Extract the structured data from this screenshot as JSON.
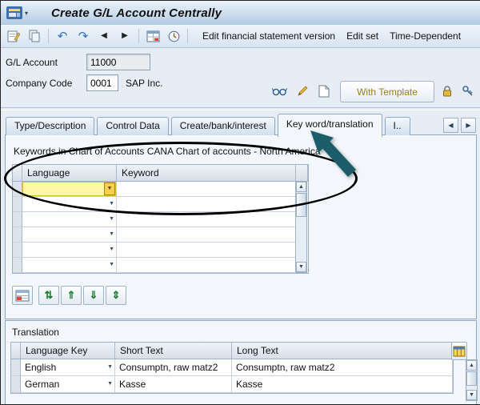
{
  "window": {
    "title": "Create G/L Account Centrally"
  },
  "toolbar": {
    "links": {
      "edit_fsv": "Edit financial statement version",
      "edit_set": "Edit set",
      "time_dependent": "Time-Dependent"
    }
  },
  "header_form": {
    "gl_account": {
      "label": "G/L Account",
      "value": "11000"
    },
    "company_code": {
      "label": "Company Code",
      "value": "0001",
      "company_name": "SAP Inc."
    },
    "with_template_label": "With Template"
  },
  "tabs": {
    "active_index": 3,
    "items": [
      {
        "label": "Type/Description"
      },
      {
        "label": "Control Data"
      },
      {
        "label": "Create/bank/interest"
      },
      {
        "label": "Key word/translation"
      },
      {
        "label": "I.."
      }
    ]
  },
  "keywords": {
    "caption": "Keywords in Chart of Accounts CANA Chart of accounts - North America",
    "columns": {
      "language": "Language",
      "keyword": "Keyword"
    },
    "empty_row_count": 6
  },
  "translation": {
    "section_title": "Translation",
    "columns": {
      "language_key": "Language Key",
      "short_text": "Short Text",
      "long_text": "Long Text"
    },
    "rows": [
      {
        "language": "English",
        "short_text": "Consumptn, raw matz2",
        "long_text": "Consumptn, raw matz2"
      },
      {
        "language": "German",
        "short_text": "Kasse",
        "long_text": "Kasse"
      }
    ]
  },
  "colors": {
    "selected_cell": "#fdf7a6",
    "annotation_arrow": "#1b5e69",
    "annotation_oval": "#000000"
  }
}
